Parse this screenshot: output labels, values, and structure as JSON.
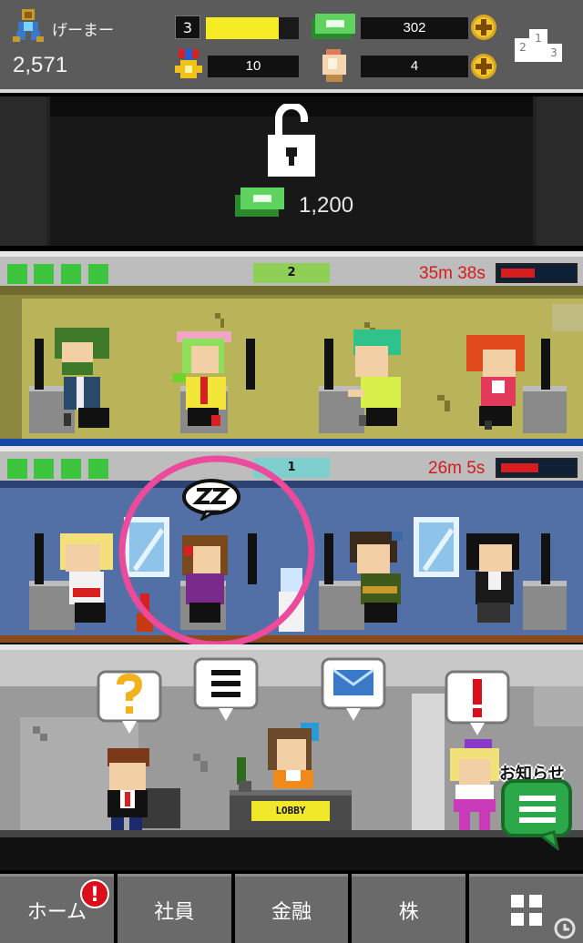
{
  "player": {
    "name": "げーまー",
    "money": "2,571"
  },
  "level": {
    "value": "3",
    "progress": 0.78
  },
  "currencies": {
    "cash": "302",
    "medals": "10",
    "gems": "4"
  },
  "locked_floor": {
    "unlock_price": "1,200"
  },
  "floors": [
    {
      "number": "2",
      "timer": "35m 38s",
      "timer_progress": 0.45,
      "theme": "yellow"
    },
    {
      "number": "1",
      "timer": "26m 5s",
      "timer_progress": 0.5,
      "theme": "blue"
    }
  ],
  "lobby": {
    "sign": "LOBBY",
    "news_label": "お知らせ"
  },
  "nav": {
    "home": "ホーム",
    "staff": "社員",
    "finance": "金融",
    "stocks": "株"
  },
  "icons": [
    "avatar-icon",
    "cash-icon",
    "medal-icon",
    "gem-icon",
    "plus-icon",
    "ranking-icon",
    "lock-icon",
    "menu-grid-icon",
    "news-icon"
  ],
  "colors": {
    "hud_bg": "#5b5b5b",
    "xp": "#f5ec26",
    "timer_red": "#d41c1c",
    "dot_green": "#3dc63d",
    "alert_red": "#d90f1b"
  }
}
